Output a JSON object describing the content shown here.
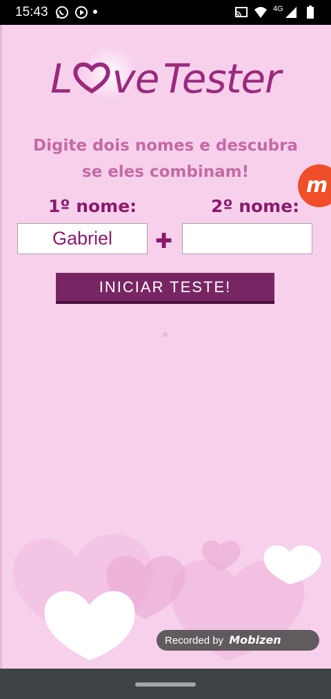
{
  "status_bar": {
    "time": "15:43",
    "network": "4G",
    "icons": [
      "whatsapp-icon",
      "play-icon",
      "cast-icon",
      "wifi-icon",
      "signal-icon",
      "battery-icon"
    ]
  },
  "app": {
    "logo_prefix": "L",
    "logo_rest": "ve",
    "logo_second": "Tester",
    "subtitle": "Digite dois nomes e descubra se eles combinam!",
    "name1_label": "1º nome:",
    "name2_label": "2º nome:",
    "name1_value": "Gabriel",
    "name2_value": "",
    "plus": "✚",
    "start_button": "INICIAR TESTE!"
  },
  "overlay": {
    "mobizen_letter": "m",
    "recorded_by": "Recorded by",
    "recorder_brand": "Mobizen"
  },
  "colors": {
    "background": "#f7d0ec",
    "brand": "#9a2a7e",
    "button": "#782663",
    "mobizen": "#f04e2a"
  }
}
